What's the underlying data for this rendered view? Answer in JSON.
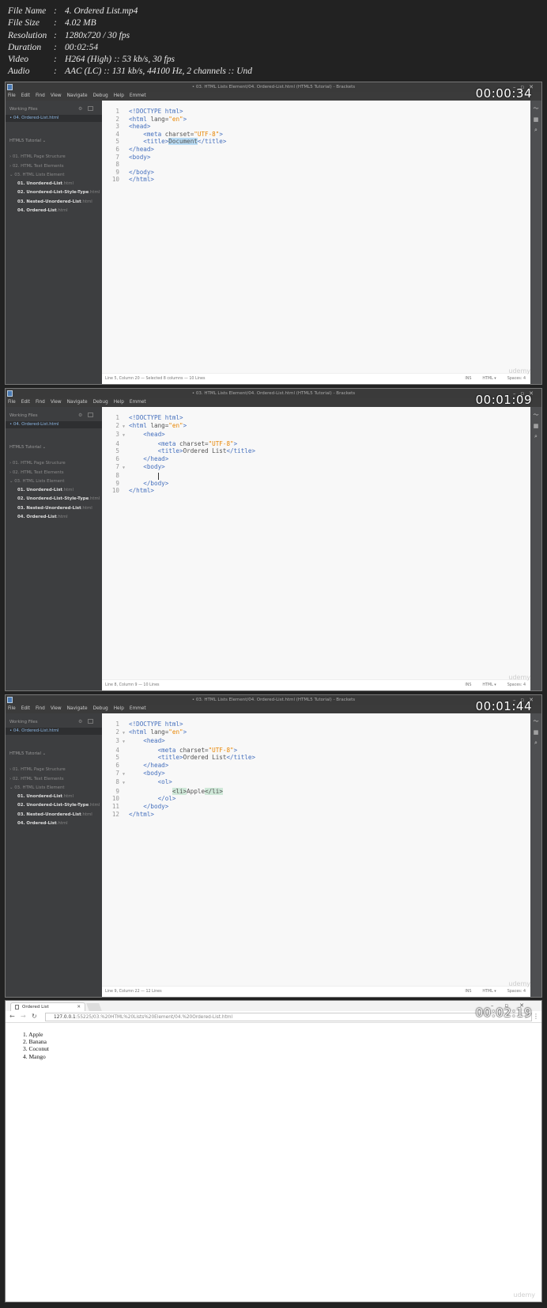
{
  "file_info": [
    {
      "key": "File Name",
      "value": "4. Ordered List.mp4"
    },
    {
      "key": "File Size",
      "value": "4.02 MB"
    },
    {
      "key": "Resolution",
      "value": "1280x720 / 30 fps"
    },
    {
      "key": "Duration",
      "value": "00:02:54"
    },
    {
      "key": "Video",
      "value": "H264 (High) :: 53 kb/s, 30 fps"
    },
    {
      "key": "Audio",
      "value": "AAC (LC) :: 131 kb/s, 44100 Hz, 2 channels :: Und"
    }
  ],
  "editor": {
    "window_title": "• 03. HTML Lists Element/04. Ordered-List.html (HTML5 Tutorial) - Brackets",
    "menu": [
      "File",
      "Edit",
      "Find",
      "View",
      "Navigate",
      "Debug",
      "Help",
      "Emmet"
    ],
    "working_files_label": "Working Files",
    "active_file": "• 04. Ordered-List.html",
    "project_label": "HTML5 Tutorial ⌄",
    "folders": [
      "› 01. HTML Page Structure",
      "› 02. HTML Text Elements",
      "⌄ 03. HTML Lists Element"
    ],
    "files": [
      {
        "name": "01. Unordered-List",
        "ext": ".html"
      },
      {
        "name": "02. Unordered-List-Style-Type",
        "ext": ".html"
      },
      {
        "name": "03. Nested-Unordered-List",
        "ext": ".html"
      },
      {
        "name": "04. Ordered-List",
        "ext": ".html"
      }
    ],
    "status_right": [
      "INS",
      "HTML ▾",
      "Spaces: 4"
    ],
    "watermark": "udemy"
  },
  "frames": [
    {
      "timestamp": "00:00:34",
      "status": "Line 5, Column 20 — Selected 8 columns — 10 Lines",
      "folds": [],
      "code": [
        [
          [
            "<!DOCTYPE html>",
            "tag"
          ]
        ],
        [
          [
            "<html ",
            "tag"
          ],
          [
            "lang=",
            ""
          ],
          [
            "\"en\"",
            "str"
          ],
          [
            ">",
            "tag"
          ]
        ],
        [
          [
            "<head>",
            "tag"
          ]
        ],
        [
          [
            "    <meta ",
            "tag"
          ],
          [
            "charset=",
            ""
          ],
          [
            "\"UTF-8\"",
            "str"
          ],
          [
            ">",
            "tag"
          ]
        ],
        [
          [
            "    <title>",
            "tag"
          ],
          [
            "Document",
            "sel"
          ],
          [
            "</title>",
            "tag"
          ]
        ],
        [
          [
            "</head>",
            "tag"
          ]
        ],
        [
          [
            "<body>",
            "tag"
          ]
        ],
        [],
        [
          [
            "</body>",
            "tag"
          ]
        ],
        [
          [
            "</html>",
            "tag"
          ]
        ]
      ]
    },
    {
      "timestamp": "00:01:09",
      "status": "Line 8, Column 9 — 10 Lines",
      "folds": [
        2,
        3,
        7
      ],
      "code": [
        [
          [
            "<!DOCTYPE html>",
            "tag"
          ]
        ],
        [
          [
            "<html ",
            "tag"
          ],
          [
            "lang=",
            ""
          ],
          [
            "\"en\"",
            "str"
          ],
          [
            ">",
            "tag"
          ]
        ],
        [
          [
            "    <head>",
            "tag"
          ]
        ],
        [
          [
            "        <meta ",
            "tag"
          ],
          [
            "charset=",
            ""
          ],
          [
            "\"UTF-8\"",
            "str"
          ],
          [
            ">",
            "tag"
          ]
        ],
        [
          [
            "        <title>",
            "tag"
          ],
          [
            "Ordered List",
            ""
          ],
          [
            "</title>",
            "tag"
          ]
        ],
        [
          [
            "    </head>",
            "tag"
          ]
        ],
        [
          [
            "    <body>",
            "tag"
          ]
        ],
        [
          [
            "        ",
            ""
          ],
          [
            "",
            "caret"
          ]
        ],
        [
          [
            "    </body>",
            "tag"
          ]
        ],
        [
          [
            "</html>",
            "tag"
          ]
        ]
      ]
    },
    {
      "timestamp": "00:01:44",
      "status": "Line 9, Column 22 — 12 Lines",
      "folds": [
        2,
        3,
        7,
        8
      ],
      "code": [
        [
          [
            "<!DOCTYPE html>",
            "tag"
          ]
        ],
        [
          [
            "<html ",
            "tag"
          ],
          [
            "lang=",
            ""
          ],
          [
            "\"en\"",
            "str"
          ],
          [
            ">",
            "tag"
          ]
        ],
        [
          [
            "    <head>",
            "tag"
          ]
        ],
        [
          [
            "        <meta ",
            "tag"
          ],
          [
            "charset=",
            ""
          ],
          [
            "\"UTF-8\"",
            "str"
          ],
          [
            ">",
            "tag"
          ]
        ],
        [
          [
            "        <title>",
            "tag"
          ],
          [
            "Ordered List",
            ""
          ],
          [
            "</title>",
            "tag"
          ]
        ],
        [
          [
            "    </head>",
            "tag"
          ]
        ],
        [
          [
            "    <body>",
            "tag"
          ]
        ],
        [
          [
            "        <ol>",
            "tag"
          ]
        ],
        [
          [
            "            ",
            ""
          ],
          [
            "<li>",
            "match"
          ],
          [
            "Apple",
            ""
          ],
          [
            "</li>",
            "match"
          ]
        ],
        [
          [
            "        </ol>",
            "tag"
          ]
        ],
        [
          [
            "    </body>",
            "tag"
          ]
        ],
        [
          [
            "</html>",
            "tag"
          ]
        ]
      ]
    }
  ],
  "browser": {
    "timestamp": "00:02:19",
    "tab_title": "Ordered List",
    "url_host": "127.0.0.1",
    "url_path": ":55225/03.%20HTML%20Lists%20Element/04.%20Ordered-List.html",
    "list_items": [
      "Apple",
      "Banana",
      "Coconut",
      "Mango"
    ],
    "watermark": "udemy"
  }
}
